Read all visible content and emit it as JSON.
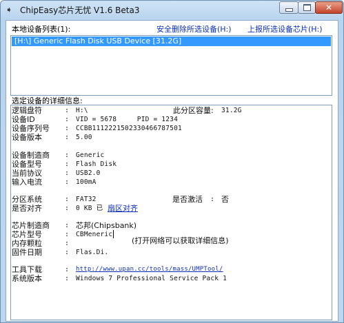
{
  "window": {
    "title": "ChipEasy芯片无忧 V1.6 Beta3",
    "close_glyph": "✕",
    "app_icon_glyph": "➧"
  },
  "header": {
    "local_devices_label": "本地设备列表(1):",
    "safe_remove_link": "安全删除所选设备(H:)",
    "report_chip_link": "上报所选设备芯片(H:)"
  },
  "device_list": {
    "items": [
      {
        "label": "[H:\\] Generic Flash Disk USB Device [31.2G]",
        "selected": true
      }
    ]
  },
  "details": {
    "label": "选定设备的详细信息:",
    "colon": ":",
    "logical_drive": {
      "label": "逻辑盘符",
      "value": "H:\\"
    },
    "partition_capacity": {
      "label": "此分区容量:",
      "value": "31.2G"
    },
    "device_id": {
      "label": "设备ID",
      "value": "VID = 5678     PID = 1234"
    },
    "serial": {
      "label": "设备序列号",
      "value": "CCBB1112221502330466787501"
    },
    "version": {
      "label": "设备版本",
      "value": "5.00"
    },
    "vendor": {
      "label": "设备制造商",
      "value": "Generic"
    },
    "model": {
      "label": "设备型号",
      "value": "Flash Disk"
    },
    "protocol": {
      "label": "当前协议",
      "value": "USB2.0"
    },
    "current": {
      "label": "输入电流",
      "value": "100mA"
    },
    "filesystem": {
      "label": "分区系统",
      "value": "FAT32"
    },
    "activated": {
      "label": "是否激活",
      "value": "否"
    },
    "aligned": {
      "label": "是否对齐",
      "value_prefix": "0 KB 已",
      "value_link": "扇区对齐"
    },
    "chip_vendor": {
      "label": "芯片制造商",
      "value": "芯邦(Chipsbank)"
    },
    "chip_model": {
      "label": "芯片型号",
      "value": "CBMeneric"
    },
    "flash": {
      "label": "内存颗粒",
      "value": ""
    },
    "firmware": {
      "label": "固件日期",
      "value": "Flas.Di."
    },
    "network_hint": "(打开网络可以获取详细信息)",
    "tool_download": {
      "label": "工具下载",
      "value": "http://www.upan.cc/tools/mass/UMPTool/"
    },
    "os_version": {
      "label": "系统版本",
      "value": "Windows 7 Professional Service Pack 1"
    }
  }
}
